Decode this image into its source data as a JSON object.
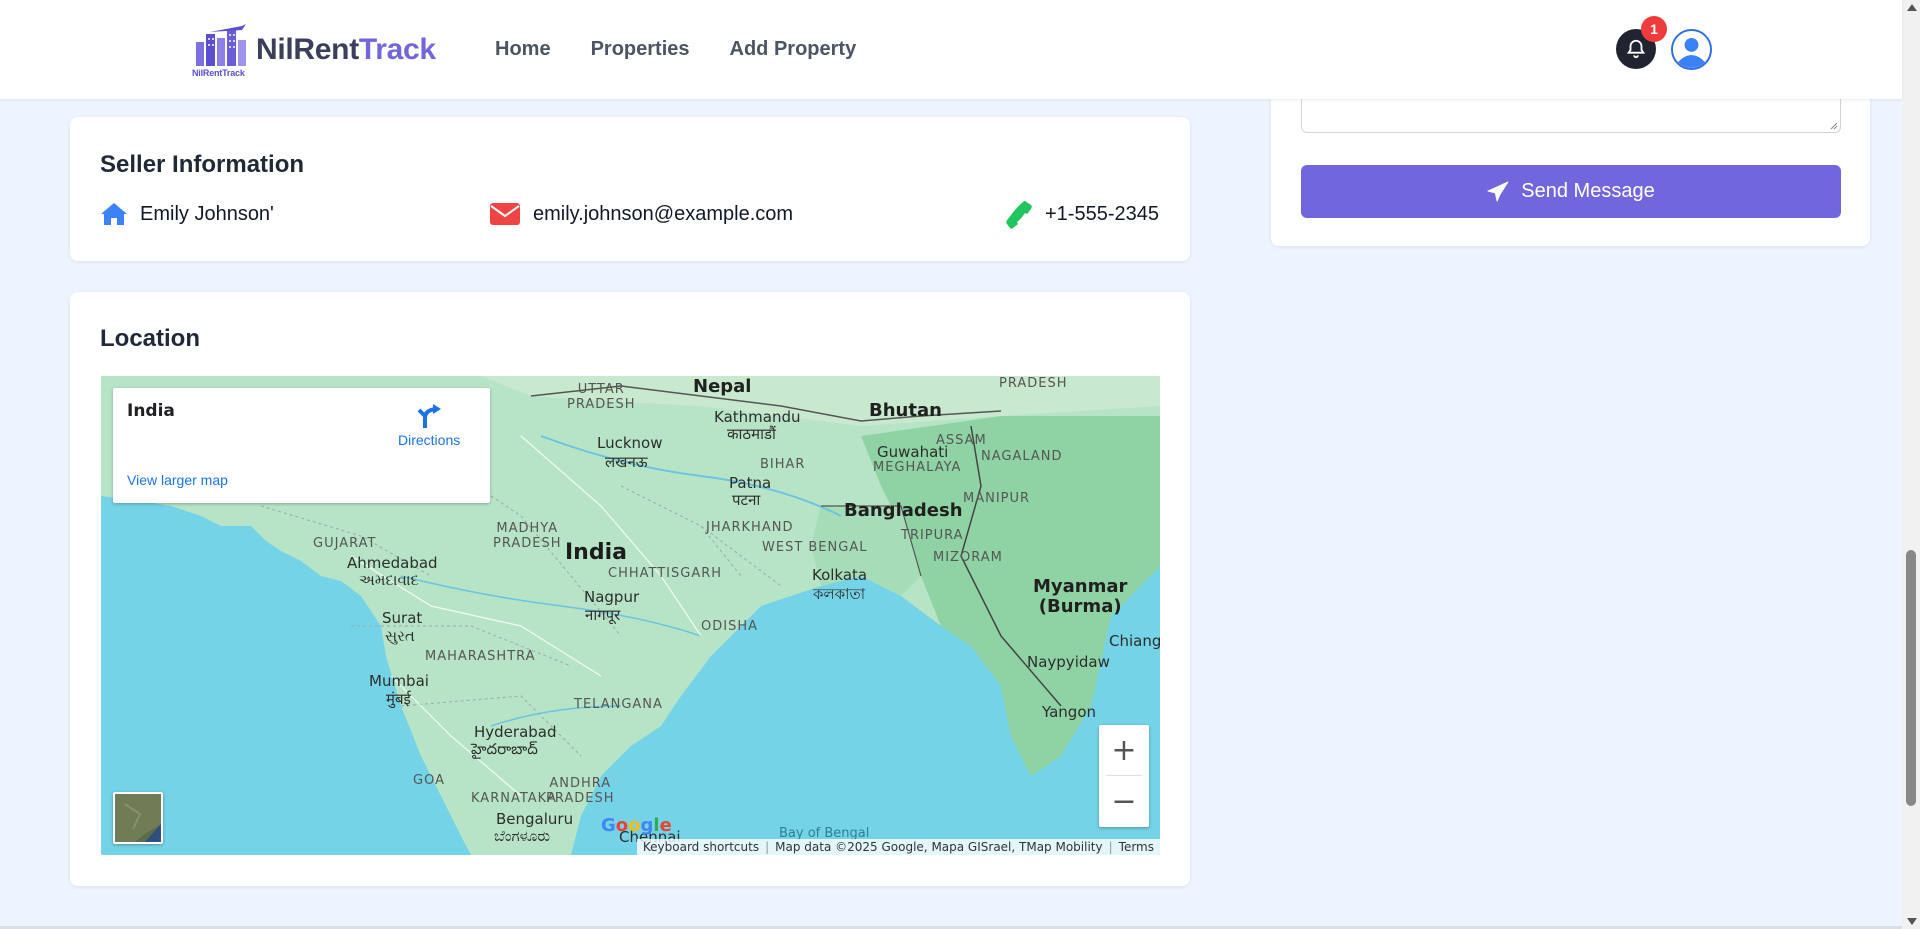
{
  "navbar": {
    "brand_part1": "NilRent",
    "brand_part2": "Track",
    "logo_caption": "NilRentTrack",
    "links": [
      "Home",
      "Properties",
      "Add Property"
    ],
    "notification_count": "1"
  },
  "seller": {
    "title": "Seller Information",
    "name": "Emily Johnson'",
    "email": "emily.johnson@example.com",
    "phone": "+1-555-2345"
  },
  "location": {
    "title": "Location",
    "map": {
      "info_title": "India",
      "directions_label": "Directions",
      "view_larger_label": "View larger map",
      "zoom_in": "+",
      "zoom_out": "−",
      "google_logo": "Google",
      "attribution": {
        "keyboard": "Keyboard shortcuts",
        "map_data": "Map data ©2025 Google, Mapa GISrael, TMap Mobility",
        "terms": "Terms"
      },
      "labels": {
        "nepal": "Nepal",
        "kathmandu": "Kathmandu",
        "kathmandu_local": "काठमाडौं",
        "bhutan": "Bhutan",
        "uttar_pradesh": "UTTAR\nPRADESH",
        "pradesh_top": "PRADESH",
        "assam": "ASSAM",
        "guwahati": "Guwahati",
        "meghalaya": "MEGHALAYA",
        "nagaland": "NAGALAND",
        "lucknow": "Lucknow",
        "lucknow_local": "लखनऊ",
        "bihar": "BIHAR",
        "patna": "Patna",
        "patna_local": "पटना",
        "bangladesh": "Bangladesh",
        "manipur": "MANIPUR",
        "gujarat": "GUJARAT",
        "madhya_pradesh": "MADHYA\nPRADESH",
        "jharkhand": "JHARKHAND",
        "tripura": "TRIPURA",
        "west_bengal": "WEST BENGAL",
        "mizoram": "MIZORAM",
        "ahmedabad": "Ahmedabad",
        "ahmedabad_local": "અમદાવાદ",
        "india": "India",
        "chhattisgarh": "CHHATTISGARH",
        "kolkata": "Kolkata",
        "kolkata_local": "কলকাতা",
        "myanmar": "Myanmar\n(Burma)",
        "nagpur": "Nagpur",
        "nagpur_local": "नागपूर",
        "surat": "Surat",
        "surat_local": "સુરત",
        "odisha": "ODISHA",
        "chiang": "Chiang",
        "maharashtra": "MAHARASHTRA",
        "naypyidaw": "Naypyidaw",
        "mumbai": "Mumbai",
        "mumbai_local": "मुंबई",
        "telangana": "TELANGANA",
        "hyderabad": "Hyderabad",
        "hyderabad_local": "హైదరాబాద్",
        "yangon": "Yangon",
        "goa": "GOA",
        "karnataka": "KARNATAKA",
        "andhra": "ANDHRA\nPRADESH",
        "bengaluru": "Bengaluru",
        "bengaluru_local": "ಬೆಂಗಳೂರು",
        "chennai": "Chennai",
        "bay_of_bengal": "Bay of Bengal"
      }
    }
  },
  "message_form": {
    "send_label": "Send Message"
  },
  "colors": {
    "accent": "#7266dc",
    "brand_dark": "#3b3f5c",
    "seller_home_icon": "#3b82f6",
    "seller_mail_icon": "#ef4444",
    "seller_phone_icon": "#22c55e",
    "badge": "#ef3b3b",
    "page_bg": "#eef4ff"
  },
  "icons": {
    "logo": "building-logo-icon",
    "bell": "bell-icon",
    "avatar": "user-avatar-icon",
    "home": "home-icon",
    "mail": "envelope-icon",
    "phone": "phone-icon",
    "directions": "directions-arrow-icon",
    "send": "paper-plane-icon"
  }
}
